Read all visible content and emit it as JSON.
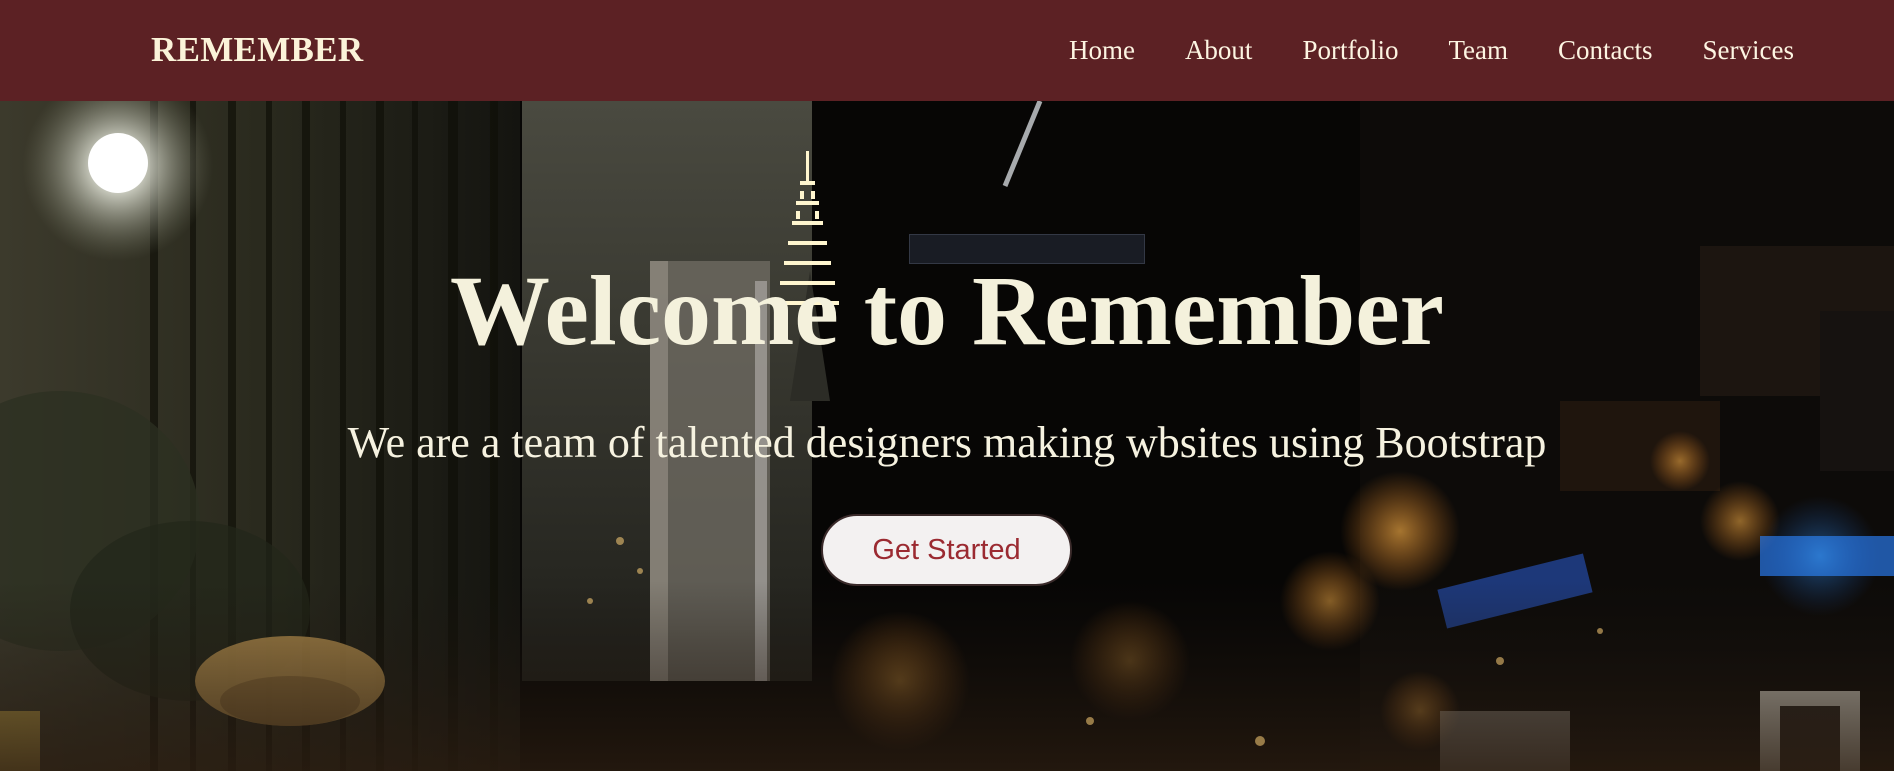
{
  "brand": {
    "name": "REMEMBER"
  },
  "nav": {
    "items": [
      {
        "label": "Home"
      },
      {
        "label": "About"
      },
      {
        "label": "Portfolio"
      },
      {
        "label": "Team"
      },
      {
        "label": "Contacts"
      },
      {
        "label": "Services"
      }
    ]
  },
  "hero": {
    "title": "Welcome to Remember",
    "subtitle": "We are a team of talented designers making wbsites using Bootstrap",
    "cta_label": "Get Started",
    "background": "night-city-street-photo"
  },
  "colors": {
    "navbar": "#5c2124",
    "nav_text": "#fdf5e2",
    "hero_text": "#f4f1dc",
    "cta_text": "#9b2a31",
    "cta_bg": "#f3f1f1"
  }
}
